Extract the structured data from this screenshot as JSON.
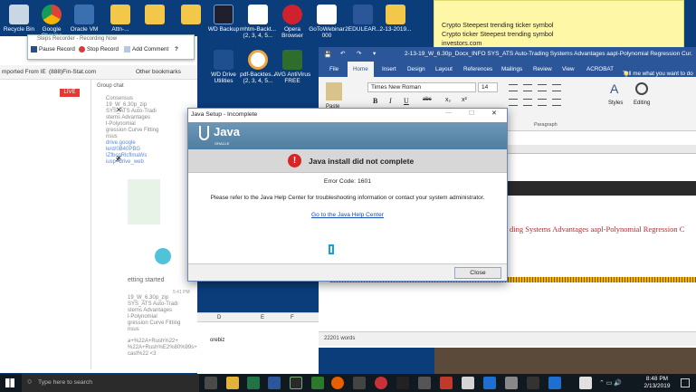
{
  "desktop_icons": [
    {
      "label": "Recycle Bin"
    },
    {
      "label": "Google Chrome"
    },
    {
      "label": "Oracle VM"
    },
    {
      "label": "Attn-..."
    },
    {
      "label": ""
    },
    {
      "label": "WD Backup"
    },
    {
      "label": "mhtm-Backt... (2, 3, 4, 5..."
    },
    {
      "label": "Opera Browser"
    },
    {
      "label": "GoToWebinar 000"
    },
    {
      "label": "2EDULEAR..."
    },
    {
      "label": "2-13-2019..."
    },
    {
      "label": "WD Drive Utilities"
    },
    {
      "label": "pdf-Backtes... (2, 3, 4, 5..."
    },
    {
      "label": "AVG AntiVirus FREE"
    }
  ],
  "sticky_note": {
    "lines": [
      "Crypto Steepest trending ticker symbol",
      "Crypto ticker Steepest trending symbol",
      "investors.com"
    ]
  },
  "browser": {
    "bookmarks": [
      "mported From IE",
      "(888)Fin-Stat.com",
      "Other bookmarks"
    ],
    "live_badge": "LIVE",
    "chat_header": "Group chat",
    "chat_fragments": [
      "Consensus",
      "19_W_6.30p_zip",
      "SYS_ATS Auto-Tradi",
      "stems Advantages",
      "l-Polynomial",
      "gression Curve Fitting",
      "nsus",
      "drive.google",
      "le/d/0B40PBG",
      "IZfbcnRlcflmaWs",
      "iusp=drive_web"
    ],
    "getting_started": "etting started",
    "time": "5:41 PM",
    "chat_fragments_2": [
      "19_W_6.30p_zip",
      "SYS_ATS Auto-Tradi",
      "stems Advantages",
      "l-Polynomial",
      "gression Curve Fitting",
      "nsus"
    ],
    "url_text": "a+%22A+Rush%22+",
    "url_text2": "%22A+Rush%E2%80%99s+Live+",
    "url_text3": "cast%22 <3",
    "sheet_cols": [
      "D",
      "E",
      "F"
    ],
    "sheet_cell": "orebiz"
  },
  "steps_recorder": {
    "title": "Steps Recorder - Recording Now",
    "pause": "Pause Record",
    "stop": "Stop Record",
    "comment": "Add Comment",
    "help": "?"
  },
  "word": {
    "title": "2-13-19_W_6.30p_Docx_INFO SYS_ATS Auto-Trading Systems Advantages aapl-Polynomial Regression Cur...",
    "tabs": [
      "File",
      "Home",
      "Insert",
      "Design",
      "Layout",
      "References",
      "Mailings",
      "Review",
      "View",
      "ACROBAT"
    ],
    "tell_me": "Tell me what you want to do",
    "font_name": "Times New Roman",
    "font_size": "14",
    "paste": "Paste",
    "paragraph": "Paragraph",
    "styles": "Styles",
    "editing": "Editing",
    "doc_text": "ding Systems Advantages aapl-Polynomial Regression C",
    "word_count": "22201 words"
  },
  "java_dialog": {
    "title": "Java Setup - Incomplete",
    "logo_text": "Java",
    "logo_sub": "ORACLE",
    "heading": "Java install did not complete",
    "error_code": "Error Code: 1601",
    "message": "Please refer to the Java Help Center for troubleshooting information or contact your system administrator.",
    "link": "Go to the Java Help Center",
    "close_button": "Close"
  },
  "taskbar": {
    "search_placeholder": "Type here to search",
    "time": "8:48 PM",
    "date": "2/13/2019"
  },
  "colors": {
    "word_blue": "#2b579a",
    "java_link": "#1a49b8",
    "error_red": "#d52525",
    "regression_text": "#c0262c"
  }
}
